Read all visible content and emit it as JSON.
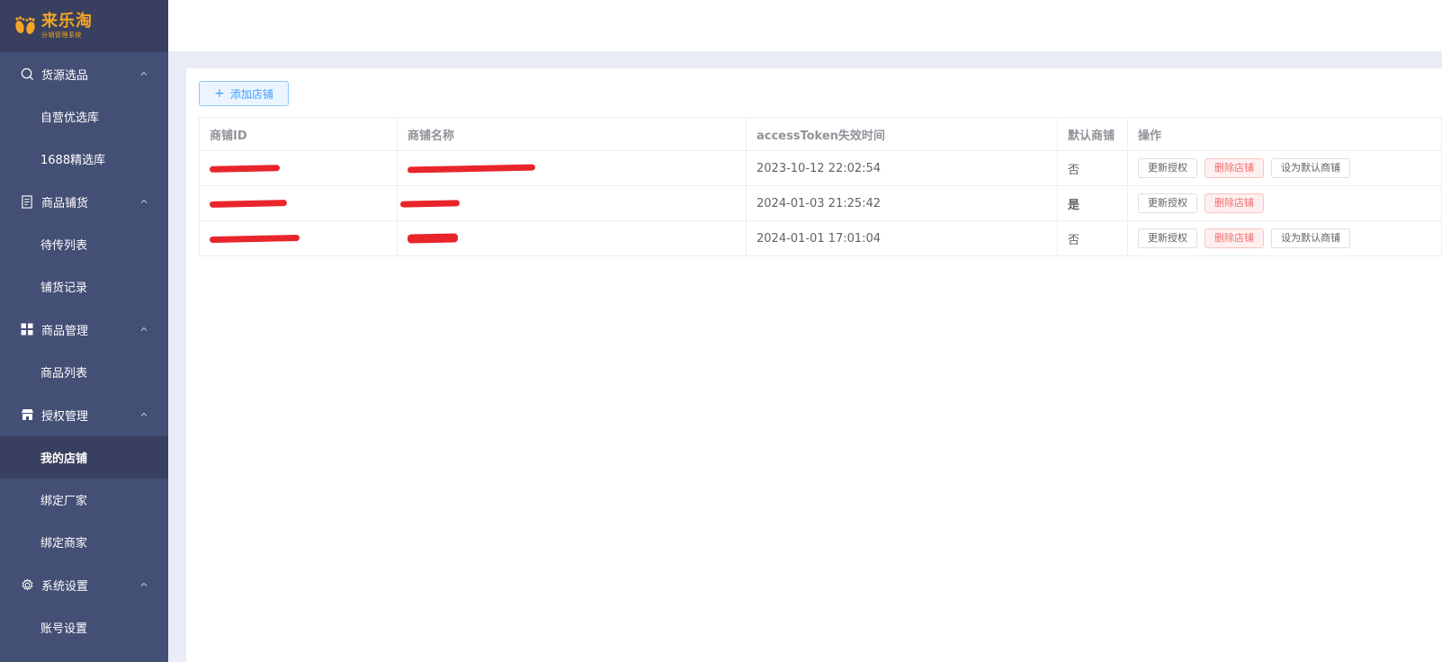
{
  "brand": {
    "title": "来乐淘",
    "subtitle": "分销管理系统"
  },
  "sidebar": {
    "groups": [
      {
        "label": "货源选品",
        "icon": "search-icon",
        "items": [
          "自营优选库",
          "1688精选库"
        ]
      },
      {
        "label": "商品铺货",
        "icon": "document-icon",
        "items": [
          "待传列表",
          "铺货记录"
        ]
      },
      {
        "label": "商品管理",
        "icon": "grid-icon",
        "items": [
          "商品列表"
        ]
      },
      {
        "label": "授权管理",
        "icon": "store-icon",
        "items": [
          "我的店铺",
          "绑定厂家",
          "绑定商家"
        ]
      },
      {
        "label": "系统设置",
        "icon": "gear-icon",
        "items": [
          "账号设置"
        ]
      }
    ],
    "active_item": "我的店铺"
  },
  "toolbar": {
    "add_label": "添加店铺"
  },
  "table": {
    "headers": [
      "商铺ID",
      "商铺名称",
      "accessToken失效时间",
      "默认商铺",
      "操作"
    ],
    "rows": [
      {
        "expire": "2023-10-12 22:02:54",
        "default": "否",
        "actions": [
          "更新授权",
          "删除店铺",
          "设为默认商铺"
        ]
      },
      {
        "expire": "2024-01-03 21:25:42",
        "default": "是",
        "actions": [
          "更新授权",
          "删除店铺"
        ]
      },
      {
        "expire": "2024-01-01 17:01:04",
        "default": "否",
        "actions": [
          "更新授权",
          "删除店铺",
          "设为默认商铺"
        ]
      }
    ]
  },
  "colors": {
    "sidebar_bg": "#444f75",
    "sidebar_active": "#39405f",
    "brand_orange": "#f5a623",
    "primary": "#409eff",
    "danger": "#f56c6c",
    "success": "#1a8a1a",
    "redaction": "#e8252b"
  }
}
